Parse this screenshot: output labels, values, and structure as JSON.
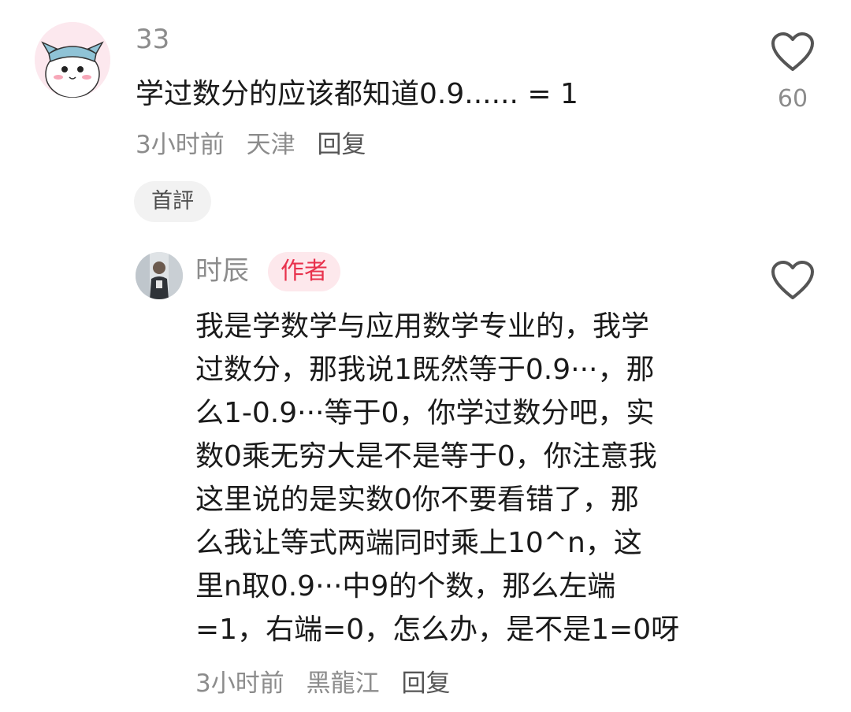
{
  "top_comment": {
    "username": "33",
    "text": "学过数分的应该都知道0.9...... = 1",
    "time": "3小时前",
    "location": "天津",
    "reply_label": "回复",
    "like_count": "60",
    "badge": "首評"
  },
  "reply": {
    "username": "时辰",
    "author_badge": "作者",
    "lines": [
      "我是学数学与应用数学专业的，我学",
      "过数分，那我说1既然等于0.9···，那",
      "么1-0.9···等于0，你学过数分吧，实",
      "数0乘无穷大是不是等于0，你注意我",
      "这里说的是实数0你不要看错了，那",
      "么我让等式两端同时乘上10^n，这",
      "里n取0.9···中9的个数，那么左端",
      "=1，右端=0，怎么办，是不是1=0呀"
    ],
    "time": "3小时前",
    "location": "黑龍江",
    "reply_label": "回复"
  },
  "colors": {
    "accent_red": "#e8324d",
    "author_badge_bg": "#fde8ec",
    "meta_gray": "#8c8c8c"
  },
  "icons": {
    "like": "heart-outline-icon"
  }
}
